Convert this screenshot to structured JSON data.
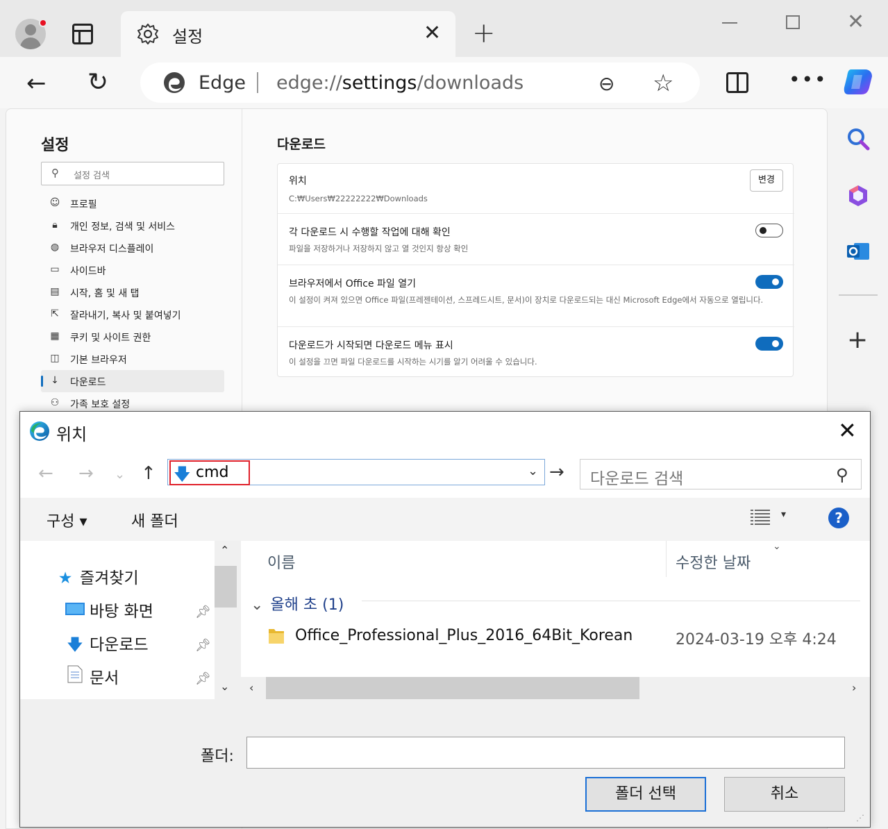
{
  "browser": {
    "tab_title": "설정",
    "tab_close": "✕",
    "new_tab": "+",
    "address_brand": "Edge",
    "url_prefix": "edge://",
    "url_main": "settings",
    "url_suffix": "/downloads"
  },
  "settings": {
    "heading": "설정",
    "search_placeholder": "설정 검색",
    "nav": [
      {
        "label": "프로필",
        "icon": "profile-icon"
      },
      {
        "label": "개인 정보, 검색 및 서비스",
        "icon": "lock-icon"
      },
      {
        "label": "브라우저 디스플레이",
        "icon": "palette-icon"
      },
      {
        "label": "사이드바",
        "icon": "sidebar-icon"
      },
      {
        "label": "시작, 홈 및 새 탭",
        "icon": "home-tab-icon"
      },
      {
        "label": "잘라내기, 복사 및 붙여넣기",
        "icon": "share-icon"
      },
      {
        "label": "쿠키 및 사이트 권한",
        "icon": "cookie-icon"
      },
      {
        "label": "기본 브라우저",
        "icon": "browser-icon"
      },
      {
        "label": "다운로드",
        "icon": "download-icon",
        "active": true
      },
      {
        "label": "가족 보호 설정",
        "icon": "family-icon"
      }
    ],
    "section_title": "다운로드",
    "location": {
      "title": "위치",
      "path": "C:₩Users₩22222222₩Downloads",
      "change_button": "변경"
    },
    "ask_each": {
      "title": "각 다운로드 시 수행할 작업에 대해 확인",
      "desc": "파일을 저장하거나 저장하지 않고 열 것인지 항상 확인",
      "enabled": false
    },
    "office_open": {
      "title": "브라우저에서 Office 파일 열기",
      "desc": "이 설정이 켜져 있으면 Office 파일(프레젠테이션, 스프레드시트, 문서)이 장치로 다운로드되는 대신 Microsoft Edge에서 자동으로 열립니다.",
      "enabled": true
    },
    "show_menu": {
      "title": "다운로드가 시작되면 다운로드 메뉴 표시",
      "desc": "이 설정을 끄면 파일 다운로드를 시작하는 시기를 알기 어려울 수 있습니다.",
      "enabled": true
    }
  },
  "dialog": {
    "title": "위치",
    "path_text": "cmd",
    "search_placeholder": "다운로드 검색",
    "organize": "구성 ▾",
    "new_folder": "새 폴더",
    "help": "?",
    "tree": [
      {
        "label": "즐겨찾기",
        "icon": "star-icon"
      },
      {
        "label": "바탕 화면",
        "icon": "desktop-icon"
      },
      {
        "label": "다운로드",
        "icon": "download-icon"
      },
      {
        "label": "문서",
        "icon": "document-icon"
      }
    ],
    "columns": {
      "name": "이름",
      "modified": "수정한 날짜"
    },
    "group_label": "올해 초 (1)",
    "files": [
      {
        "name": "Office_Professional_Plus_2016_64Bit_Korean",
        "modified": "2024-03-19 오후 4:24"
      }
    ],
    "folder_label": "폴더:",
    "folder_value": "",
    "select_button": "폴더 선택",
    "cancel_button": "취소"
  },
  "colors": {
    "accent": "#0f6cbd",
    "highlight_red": "#e0202a",
    "group_blue": "#1e3f8a"
  }
}
